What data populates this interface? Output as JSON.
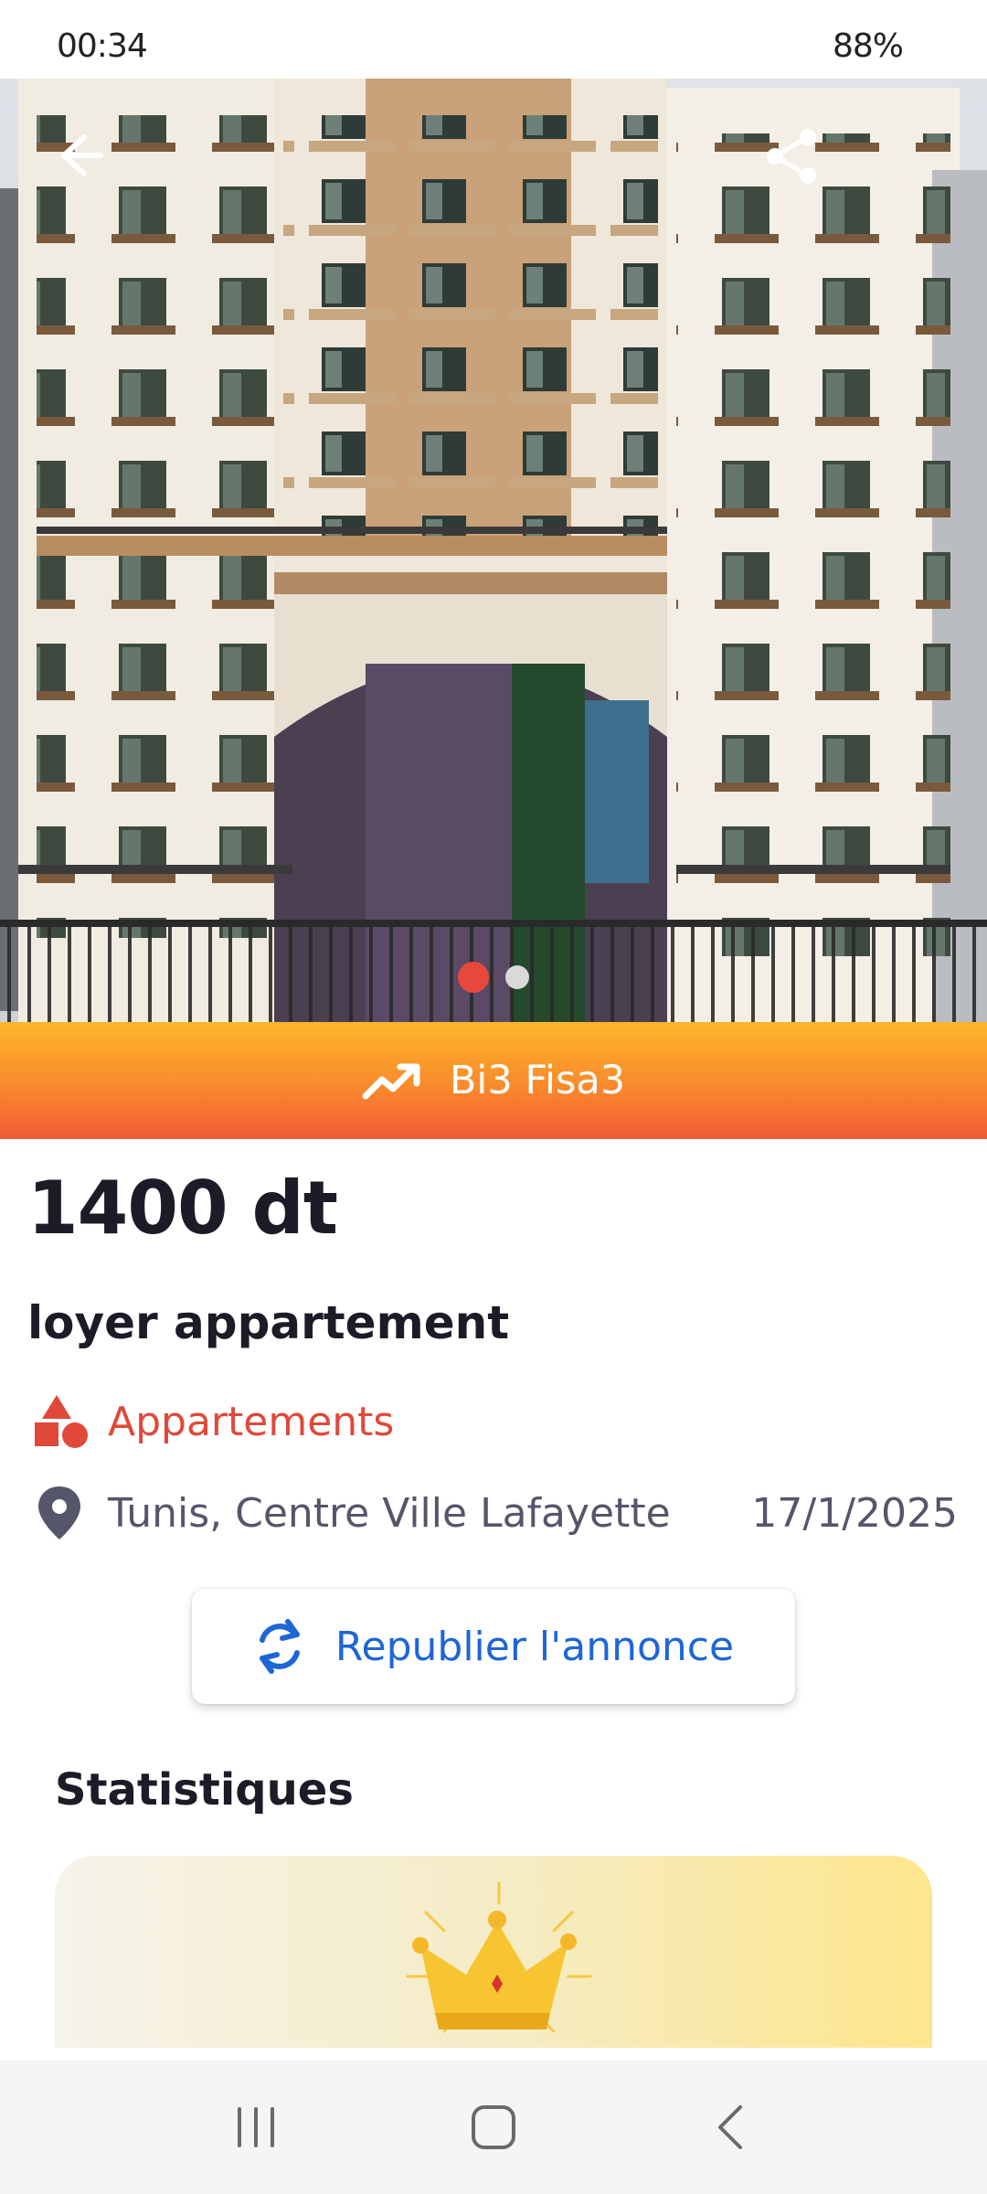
{
  "status_bar": {
    "time": "00:34",
    "battery": "88%"
  },
  "gallery": {
    "image_count": 2,
    "active_index": 0
  },
  "promo": {
    "label": "Bi3 Fisa3",
    "icon": "trending-up-icon"
  },
  "listing": {
    "price": "1400 dt",
    "title": "loyer appartement",
    "category": "Appartements",
    "location": "Tunis, Centre Ville Lafayette",
    "date": "17/1/2025"
  },
  "actions": {
    "republish_label": "Republier l'annonce"
  },
  "stats": {
    "heading": "Statistiques"
  },
  "colors": {
    "accent_red": "#e0483a",
    "link_blue": "#1e66d6",
    "promo_gradient_top": "#fdb62a",
    "promo_gradient_bottom": "#f05a37"
  },
  "nav": {
    "icons": [
      "recent-apps-icon",
      "home-icon",
      "back-icon"
    ]
  }
}
